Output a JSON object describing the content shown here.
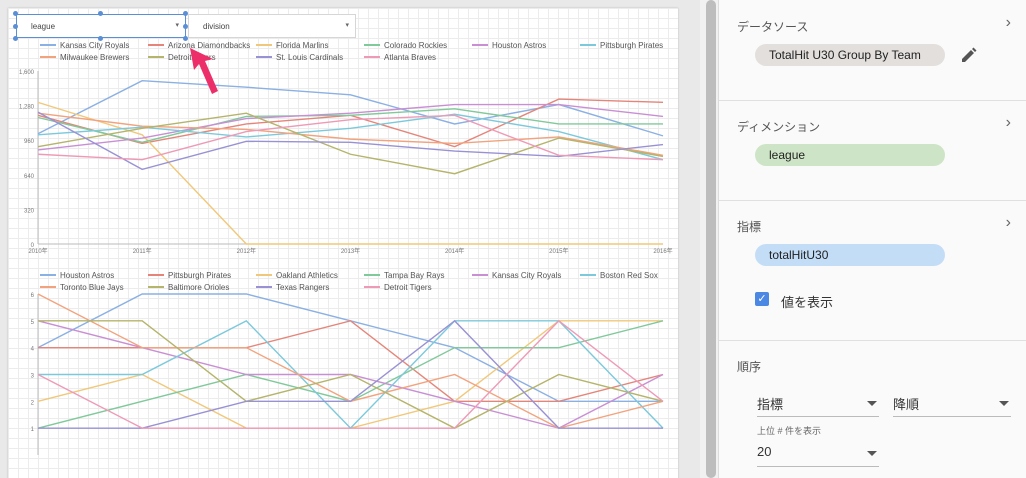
{
  "controls": {
    "league_selector": "league",
    "division_selector": "division"
  },
  "panel": {
    "data_source_title": "データソース",
    "data_source_value": "TotalHit U30 Group By Team",
    "dimension_title": "ディメンション",
    "dimension_value": "league",
    "metric_title": "指標",
    "metric_value": "totalHitU30",
    "show_values_label": "値を表示",
    "order_title": "順序",
    "sort_field": "指標",
    "sort_direction": "降順",
    "top_n_label": "上位 # 件を表示",
    "top_n_value": "20",
    "colors": {
      "chip_gray": "#e2dfdd",
      "chip_green": "#cde5c6",
      "chip_blue": "#c4ddf7",
      "checkbox": "#4a88e3"
    }
  },
  "chart_data": [
    {
      "type": "line",
      "x": [
        "2010年",
        "2011年",
        "2012年",
        "2013年",
        "2014年",
        "2015年",
        "2016年"
      ],
      "ylim": [
        0,
        1600
      ],
      "yticks": [
        "0",
        "320",
        "640",
        "960",
        "1,280",
        "1,600"
      ],
      "grid": true,
      "legend": "top",
      "series": [
        {
          "name": "Kansas City Royals",
          "color": "#8bb0e3",
          "values": [
            1020,
            1510,
            1450,
            1380,
            1110,
            1290,
            1000
          ]
        },
        {
          "name": "Arizona Diamondbacks",
          "color": "#e58579",
          "values": [
            1190,
            930,
            1110,
            1190,
            900,
            1340,
            1310
          ]
        },
        {
          "name": "Florida Marlins",
          "color": "#f1c87a",
          "values": [
            1310,
            1010,
            0,
            0,
            0,
            0,
            0
          ]
        },
        {
          "name": "Colorado Rockies",
          "color": "#80c99a",
          "values": [
            1170,
            940,
            1180,
            1190,
            1250,
            1110,
            1110
          ]
        },
        {
          "name": "Houston Astros",
          "color": "#c98fd4",
          "values": [
            870,
            980,
            1160,
            1210,
            1290,
            1290,
            1180
          ]
        },
        {
          "name": "Pittsburgh Pirates",
          "color": "#7cc9dc",
          "values": [
            1010,
            1080,
            990,
            1070,
            1200,
            1040,
            780
          ]
        },
        {
          "name": "Milwaukee Brewers",
          "color": "#f2a37e",
          "values": [
            1210,
            1090,
            1060,
            970,
            930,
            990,
            820
          ]
        },
        {
          "name": "Detroit Tigers",
          "color": "#b5b46b",
          "values": [
            900,
            1070,
            1210,
            830,
            650,
            980,
            810
          ]
        },
        {
          "name": "St. Louis Cardinals",
          "color": "#9892d5",
          "values": [
            1220,
            690,
            950,
            940,
            860,
            810,
            920
          ]
        },
        {
          "name": "Atlanta Braves",
          "color": "#ee9ab6",
          "values": [
            830,
            780,
            1040,
            1150,
            1190,
            820,
            780
          ]
        }
      ]
    },
    {
      "type": "line",
      "x": [
        "2010年",
        "2011年",
        "2012年",
        "2013年",
        "2014年",
        "2015年",
        "2016年"
      ],
      "ylim": [
        0,
        6
      ],
      "yticks": [
        "1",
        "2",
        "3",
        "4",
        "5",
        "6"
      ],
      "grid": true,
      "legend": "top",
      "series": [
        {
          "name": "Houston Astros",
          "color": "#8bb0e3",
          "values": [
            4,
            6,
            6,
            5,
            4,
            2,
            2
          ]
        },
        {
          "name": "Pittsburgh Pirates",
          "color": "#e58579",
          "values": [
            4,
            4,
            4,
            5,
            2,
            2,
            3
          ]
        },
        {
          "name": "Oakland Athletics",
          "color": "#f1c87a",
          "values": [
            2,
            3,
            1,
            1,
            2,
            5,
            5
          ]
        },
        {
          "name": "Tampa Bay Rays",
          "color": "#80c99a",
          "values": [
            1,
            2,
            3,
            2,
            4,
            4,
            5
          ]
        },
        {
          "name": "Kansas City Royals",
          "color": "#c98fd4",
          "values": [
            5,
            4,
            3,
            3,
            2,
            1,
            3
          ]
        },
        {
          "name": "Boston Red Sox",
          "color": "#7cc9dc",
          "values": [
            3,
            3,
            5,
            1,
            5,
            5,
            1
          ]
        },
        {
          "name": "Toronto Blue Jays",
          "color": "#f2a37e",
          "values": [
            6,
            4,
            4,
            2,
            3,
            1,
            2
          ]
        },
        {
          "name": "Baltimore Orioles",
          "color": "#b5b46b",
          "values": [
            5,
            5,
            2,
            3,
            1,
            3,
            2
          ]
        },
        {
          "name": "Texas Rangers",
          "color": "#9892d5",
          "values": [
            1,
            1,
            2,
            2,
            5,
            1,
            1
          ]
        },
        {
          "name": "Detroit Tigers",
          "color": "#ee9ab6",
          "values": [
            3,
            1,
            1,
            1,
            1,
            5,
            2
          ]
        }
      ]
    }
  ]
}
